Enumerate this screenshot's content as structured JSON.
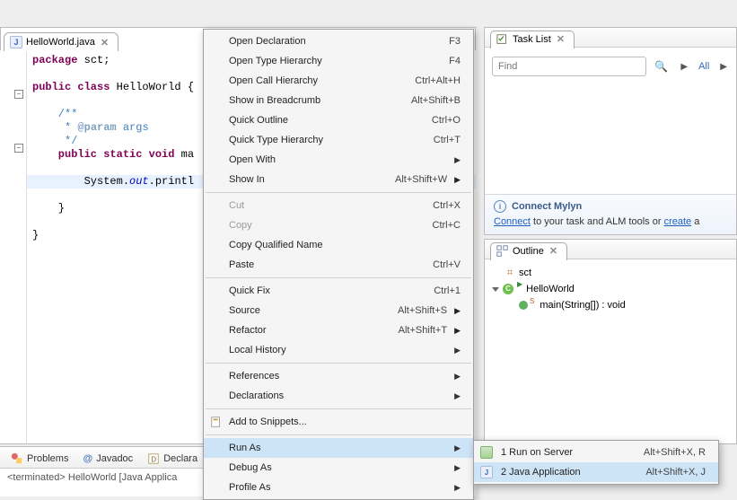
{
  "editor": {
    "tab_title": "HelloWorld.java",
    "code": {
      "l1a": "package",
      "l1b": " sct;",
      "l3a": "public class",
      "l3b": " HelloWorld {",
      "l5": "    /**",
      "l6a": "     * ",
      "l6b": "@param",
      "l6c": " args",
      "l7": "     */",
      "l8a": "    public static void",
      "l8b": " ma",
      "l10a": "        System.",
      "l10b": "out",
      "l10c": ".printl",
      "l12": "    }",
      "l14": "}"
    }
  },
  "context_menu": {
    "items": [
      {
        "label": "Open Declaration",
        "shortcut": "F3"
      },
      {
        "label": "Open Type Hierarchy",
        "shortcut": "F4"
      },
      {
        "label": "Open Call Hierarchy",
        "shortcut": "Ctrl+Alt+H"
      },
      {
        "label": "Show in Breadcrumb",
        "shortcut": "Alt+Shift+B"
      },
      {
        "label": "Quick Outline",
        "shortcut": "Ctrl+O"
      },
      {
        "label": "Quick Type Hierarchy",
        "shortcut": "Ctrl+T"
      },
      {
        "label": "Open With",
        "submenu": true
      },
      {
        "label": "Show In",
        "shortcut": "Alt+Shift+W",
        "submenu": true
      },
      {
        "sep": true
      },
      {
        "label": "Cut",
        "shortcut": "Ctrl+X",
        "disabled": true
      },
      {
        "label": "Copy",
        "shortcut": "Ctrl+C",
        "disabled": true
      },
      {
        "label": "Copy Qualified Name"
      },
      {
        "label": "Paste",
        "shortcut": "Ctrl+V"
      },
      {
        "sep": true
      },
      {
        "label": "Quick Fix",
        "shortcut": "Ctrl+1"
      },
      {
        "label": "Source",
        "shortcut": "Alt+Shift+S",
        "submenu": true
      },
      {
        "label": "Refactor",
        "shortcut": "Alt+Shift+T",
        "submenu": true
      },
      {
        "label": "Local History",
        "submenu": true
      },
      {
        "sep": true
      },
      {
        "label": "References",
        "submenu": true
      },
      {
        "label": "Declarations",
        "submenu": true
      },
      {
        "sep": true
      },
      {
        "label": "Add to Snippets...",
        "icon": "snippet"
      },
      {
        "sep": true
      },
      {
        "label": "Run As",
        "submenu": true,
        "hover": true
      },
      {
        "label": "Debug As",
        "submenu": true
      },
      {
        "label": "Profile As",
        "submenu": true
      }
    ]
  },
  "runas_submenu": {
    "items": [
      {
        "num": "1",
        "label": "1 Run on Server",
        "shortcut": "Alt+Shift+X, R",
        "icon": "server"
      },
      {
        "num": "2",
        "label": "2 Java Application",
        "shortcut": "Alt+Shift+X, J",
        "icon": "java",
        "hover": true
      }
    ]
  },
  "task_list": {
    "title": "Task List",
    "find_placeholder": "Find",
    "all_label": "All"
  },
  "mylyn": {
    "title": "Connect Mylyn",
    "text_prefix": "",
    "connect_label": "Connect",
    "text_mid": " to your task and ALM tools or ",
    "create_label": "create",
    "text_suffix": " a"
  },
  "outline": {
    "title": "Outline",
    "pkg": "sct",
    "class": "HelloWorld",
    "method": "main(String[]) : void"
  },
  "bottom": {
    "tabs": {
      "problems": "Problems",
      "javadoc": "Javadoc",
      "declaration": "Declara"
    },
    "status": "<terminated> HelloWorld [Java Applica"
  }
}
